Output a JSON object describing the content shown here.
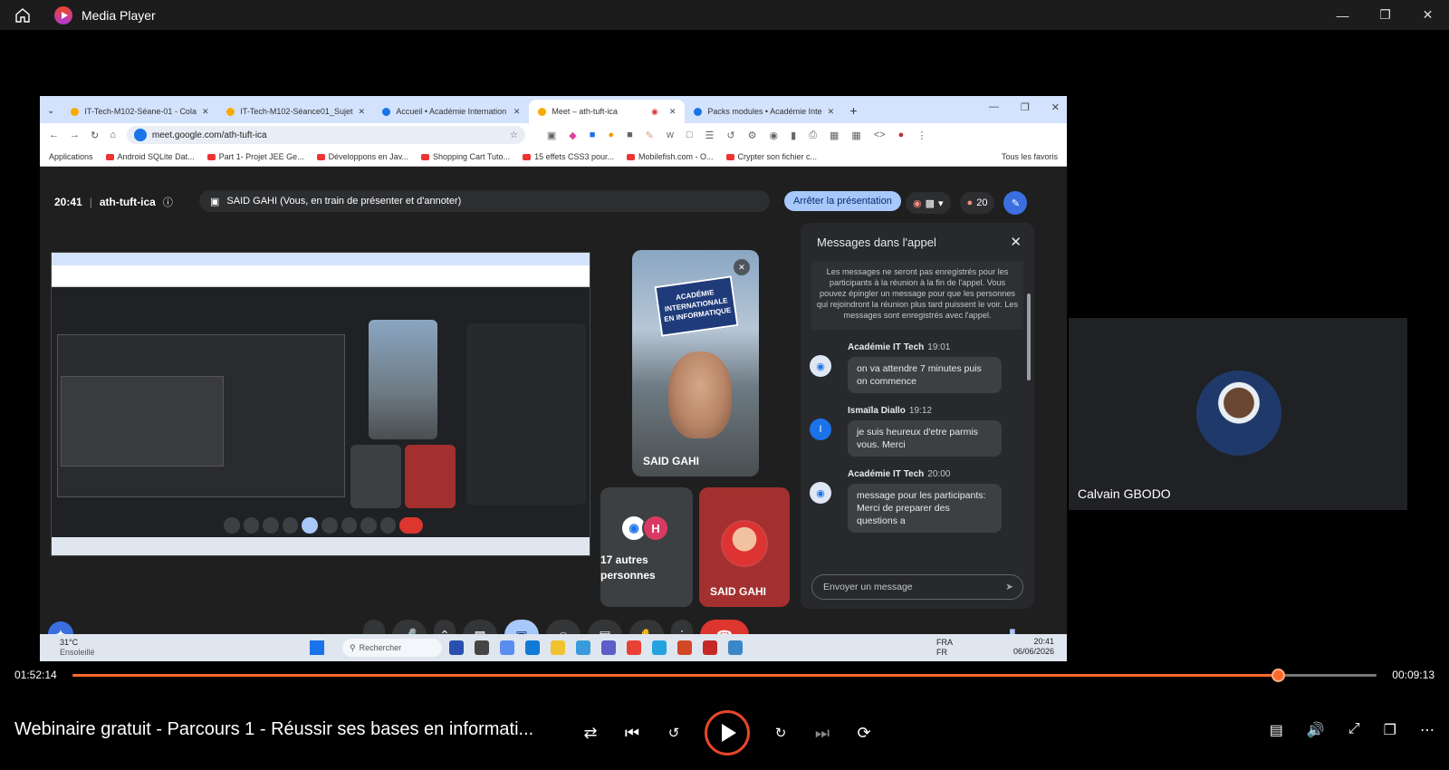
{
  "window": {
    "title": "Media Player"
  },
  "browser": {
    "tabs": [
      {
        "label": "IT-Tech-M102-Séane-01 - Cola",
        "active": false
      },
      {
        "label": "IT-Tech-M102-Séance01_Sujet",
        "active": false
      },
      {
        "label": "Accueil • Académie Internation",
        "active": false
      },
      {
        "label": "Meet – ath-tuft-ica",
        "active": true
      },
      {
        "label": "Packs modules • Académie Inte",
        "active": false
      }
    ],
    "url": "meet.google.com/ath-tuft-ica",
    "bookmarks": [
      "Applications",
      "Android SQLite Dat...",
      "Part 1- Projet JEE Ge...",
      "Développons en Jav...",
      "Shopping Cart Tuto...",
      "15 effets CSS3 pour...",
      "Mobilefish.com - O...",
      "Crypter son fichier c..."
    ],
    "favorites_label": "Tous les favoris"
  },
  "meet": {
    "time": "20:41",
    "code": "ath-tuft-ica",
    "presenting_banner": "SAID GAHI (Vous, en train de présenter et d'annoter)",
    "stop_button": "Arrêter la présentation",
    "participant_count": "20",
    "tiles": {
      "big_label": "SAID GAHI",
      "sign_text": "ACADÉMIE INTERNATIONALE EN INFORMATIQUE",
      "others_avatar_letter": "H",
      "others_label": "17 autres personnes",
      "said_label": "SAID GAHI"
    },
    "chat": {
      "title": "Messages dans l'appel",
      "notice": "Les messages ne seront pas enregistrés pour les participants à la réunion à la fin de l'appel. Vous pouvez épingler un message pour que les personnes qui rejoindront la réunion plus tard puissent le voir. Les messages sont enregistrés avec l'appel.",
      "messages": [
        {
          "sender": "Académie IT Tech",
          "time": "19:01",
          "text": "on va attendre 7 minutes puis on commence",
          "avatar": ""
        },
        {
          "sender": "Ismaïla Diallo",
          "time": "19:12",
          "text": "je suis heureux d'etre parmis vous. Merci",
          "avatar": "I"
        },
        {
          "sender": "Académie IT Tech",
          "time": "20:00",
          "text": "message pour les participants: Merci de preparer des questions a",
          "avatar": ""
        }
      ],
      "input_placeholder": "Envoyer un message"
    }
  },
  "taskbar": {
    "temperature": "31°C",
    "weather": "Ensoleillé",
    "search": "Rechercher",
    "lang": "FRA",
    "lang2": "FR",
    "clock": "20:41",
    "date": "06/06/2026"
  },
  "side_participant": {
    "name": "Calvain GBODO"
  },
  "playback": {
    "elapsed": "01:52:14",
    "remaining": "00:09:13",
    "progress_fraction": 0.924,
    "accent_color": "#ff6a2a"
  },
  "video_title": "Webinaire gratuit - Parcours 1 - Réussir ses bases en informati..."
}
